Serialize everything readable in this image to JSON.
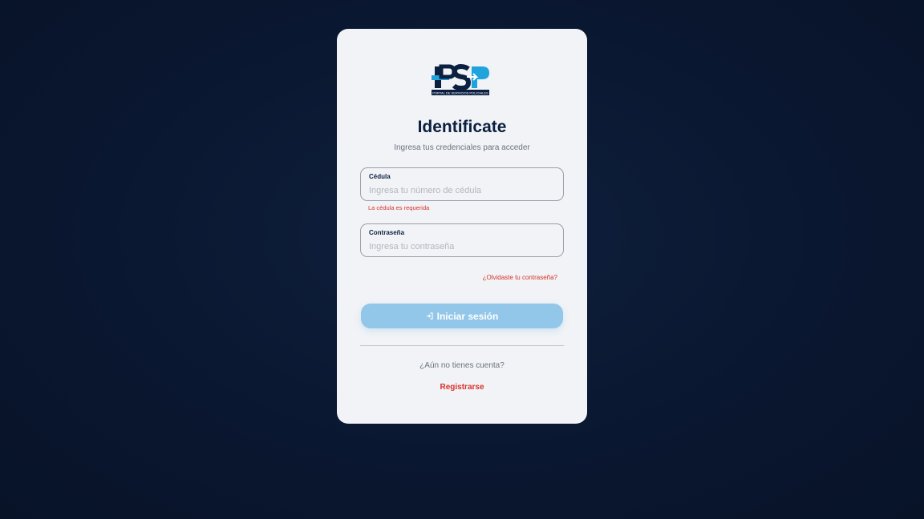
{
  "logo": {
    "text": "PSP",
    "tagline": "PORTAL DE SERVICIOS POLICIALES",
    "colors": {
      "primary": "#1ea3dd",
      "dark": "#0b1f40"
    }
  },
  "login": {
    "title": "Identificate",
    "subtitle": "Ingresa tus credenciales para acceder",
    "cedula": {
      "label": "Cédula",
      "placeholder": "Ingresa tu número de cédula",
      "value": "",
      "error": "La cédula es requerida"
    },
    "password": {
      "label": "Contraseña",
      "placeholder": "Ingresa tu contraseña",
      "value": ""
    },
    "forgot_link": "¿Olvidaste tu contraseña?",
    "submit_label": "Iniciar sesión",
    "submit_icon": "login-arrow-icon",
    "no_account_text": "¿Aún no tienes cuenta?",
    "register_link": "Registrarse"
  },
  "colors": {
    "background": "#0a1730",
    "card": "#f1f3f6",
    "accent_button": "#93c7e9",
    "error": "#d9322b",
    "title": "#0b1f40"
  }
}
